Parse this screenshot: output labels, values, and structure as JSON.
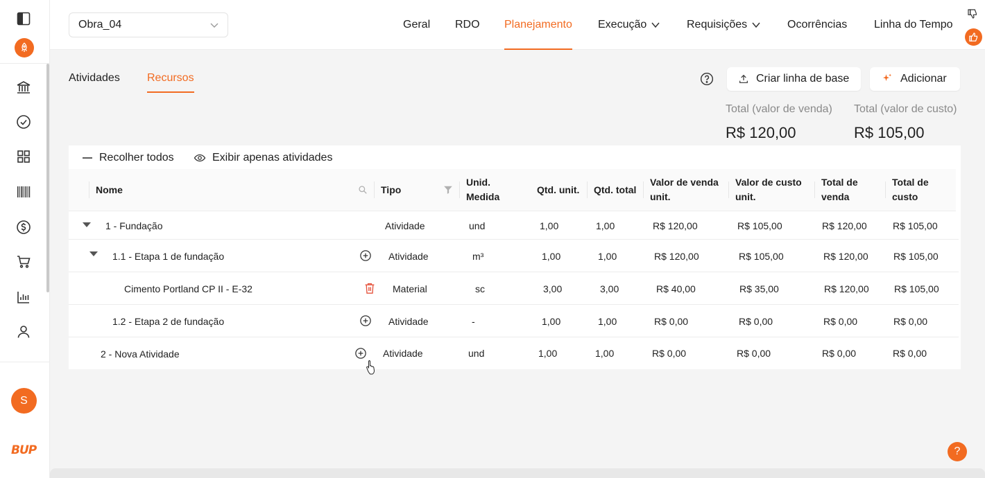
{
  "header": {
    "project": "Obra_04",
    "nav": [
      {
        "label": "Geral"
      },
      {
        "label": "RDO"
      },
      {
        "label": "Planejamento"
      },
      {
        "label": "Execução"
      },
      {
        "label": "Requisições"
      },
      {
        "label": "Ocorrências"
      },
      {
        "label": "Linha do Tempo"
      }
    ]
  },
  "sidebar": {
    "icons": [
      "panel-toggle-icon",
      "rocket-icon",
      "bank-icon",
      "check-circle-icon",
      "grid-icon",
      "barcode-icon",
      "dollar-icon",
      "cart-icon",
      "bar-chart-icon",
      "user-icon"
    ],
    "avatar": "S",
    "logo": "BUP"
  },
  "subtabs": [
    {
      "label": "Atividades"
    },
    {
      "label": "Recursos"
    }
  ],
  "actions": {
    "baseline_label": "Criar linha de base",
    "add_label": "Adicionar"
  },
  "totals": {
    "sale_label": "Total (valor de venda)",
    "sale_value": "R$ 120,00",
    "cost_label": "Total (valor de custo)",
    "cost_value": "R$ 105,00"
  },
  "toolbar": {
    "collapse_label": "Recolher todos",
    "show_only_label": "Exibir apenas atividades"
  },
  "table": {
    "headers": {
      "name": "Nome",
      "type": "Tipo",
      "unit_l1": "Unid.",
      "unit_l2": "Medida",
      "qty_unit": "Qtd. unit.",
      "qty_total": "Qtd. total",
      "sale_unit_l1": "Valor de venda",
      "sale_unit_l2": "unit.",
      "cost_unit_l1": "Valor de custo",
      "cost_unit_l2": "unit.",
      "total_sale_l1": "Total de",
      "total_sale_l2": "venda",
      "total_cost_l1": "Total de",
      "total_cost_l2": "custo"
    },
    "rows": [
      {
        "name": "1 - Fundação",
        "type": "Atividade",
        "unit": "und",
        "qty_unit": "1,00",
        "qty_total": "1,00",
        "sale_unit": "R$ 120,00",
        "cost_unit": "R$ 105,00",
        "total_sale": "R$ 120,00",
        "total_cost": "R$ 105,00"
      },
      {
        "name": "1.1 - Etapa 1 de fundação",
        "type": "Atividade",
        "unit": "m³",
        "qty_unit": "1,00",
        "qty_total": "1,00",
        "sale_unit": "R$ 120,00",
        "cost_unit": "R$ 105,00",
        "total_sale": "R$ 120,00",
        "total_cost": "R$ 105,00"
      },
      {
        "name": "Cimento Portland CP II - E-32",
        "type": "Material",
        "unit": "sc",
        "qty_unit": "3,00",
        "qty_total": "3,00",
        "sale_unit": "R$ 40,00",
        "cost_unit": "R$ 35,00",
        "total_sale": "R$ 120,00",
        "total_cost": "R$ 105,00"
      },
      {
        "name": "1.2 - Etapa 2 de fundação",
        "type": "Atividade",
        "unit": "-",
        "qty_unit": "1,00",
        "qty_total": "1,00",
        "sale_unit": "R$ 0,00",
        "cost_unit": "R$ 0,00",
        "total_sale": "R$ 0,00",
        "total_cost": "R$ 0,00"
      },
      {
        "name": "2 - Nova Atividade",
        "type": "Atividade",
        "unit": "und",
        "qty_unit": "1,00",
        "qty_total": "1,00",
        "sale_unit": "R$ 0,00",
        "cost_unit": "R$ 0,00",
        "total_sale": "R$ 0,00",
        "total_cost": "R$ 0,00"
      }
    ]
  },
  "help": {
    "label": "?"
  },
  "colors": {
    "accent": "#f26b21",
    "delete": "#e5533d"
  }
}
